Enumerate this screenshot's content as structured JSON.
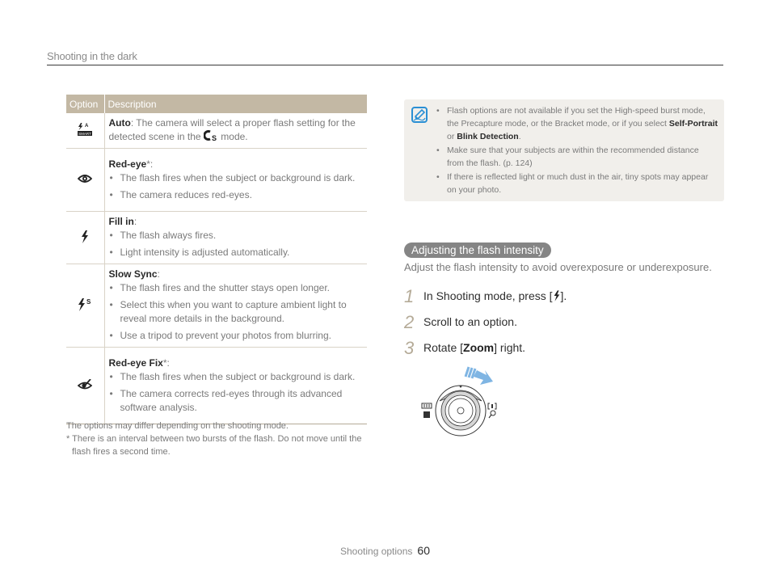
{
  "header": {
    "title": "Shooting in the dark"
  },
  "table": {
    "columns": [
      "Option",
      "Description"
    ],
    "rows": [
      {
        "icon": "flash-auto-icon",
        "term": "Auto",
        "sep": ": ",
        "text": "The camera will select a proper flash setting for the detected scene in the",
        "icon_inline": "smart-auto-mode-icon",
        "text_after": " mode."
      },
      {
        "icon": "red-eye-icon",
        "term": "Red-eye",
        "sep": "*:",
        "bullets": [
          "The flash fires when the subject or background is dark.",
          "The camera reduces red-eyes."
        ]
      },
      {
        "icon": "flash-fill-in-icon",
        "term": "Fill in",
        "sep": ":",
        "bullets": [
          "The flash always fires.",
          "Light intensity is adjusted automatically."
        ]
      },
      {
        "icon": "flash-slow-sync-icon",
        "term": "Slow Sync",
        "sep": ":",
        "bullets": [
          "The flash fires and the shutter stays open longer.",
          "Select this when you want to capture ambient light to reveal more details in the background.",
          "Use a tripod to prevent your photos from blurring."
        ]
      },
      {
        "icon": "red-eye-fix-icon",
        "term": "Red-eye Fix",
        "sep": "*:",
        "bullets": [
          "The flash fires when the subject or background is dark.",
          "The camera corrects red-eyes through its advanced software analysis."
        ]
      }
    ],
    "notes": [
      "The options may differ depending on the shooting mode.",
      "* There is an interval between two bursts of the flash. Do not move until the flash fires a second time."
    ]
  },
  "note_box": {
    "items": [
      {
        "text": "Flash options are not available if you set the High-speed burst mode, the Precapture mode, or the Bracket mode, or if you select ",
        "bold1": "Self-Portrait",
        "mid": " or ",
        "bold2": "Blink Detection",
        "end": "."
      },
      {
        "text": "Make sure that your subjects are within the recommended distance from the flash. (p. 124)"
      },
      {
        "text": "If there is reflected light or much dust in the air, tiny spots may appear on your photo."
      }
    ]
  },
  "section": {
    "title": "Adjusting the flash intensity",
    "intro": "Adjust the flash intensity to avoid overexposure or underexposure.",
    "steps": [
      {
        "num": "1",
        "pre": "In Shooting mode, press [",
        "icon": "flash-button-icon",
        "post": "]."
      },
      {
        "num": "2",
        "pre": "Scroll to an option."
      },
      {
        "num": "3",
        "pre": "Rotate [",
        "bold": "Zoom",
        "post": "] right."
      }
    ]
  },
  "footer": {
    "section": "Shooting options",
    "page": "60"
  },
  "colors": {
    "table_header": "#c3b8a4",
    "pill": "#858585",
    "note_bg": "#f1efeb",
    "note_icon": "#2a8fd4",
    "arrow": "#7fb5e3"
  }
}
